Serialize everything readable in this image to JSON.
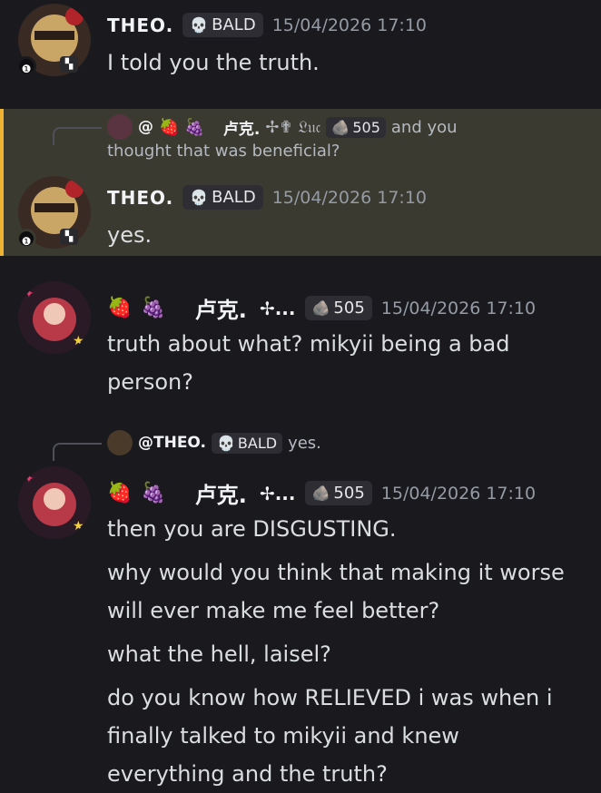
{
  "messages": [
    {
      "author": "THEO.",
      "tag": "BALD",
      "tag_icon": "skull",
      "timestamp": "15/04/2026 17:10",
      "lines": [
        "I told you the truth."
      ]
    },
    {
      "reply": {
        "mention": "@",
        "author": "卢克.",
        "suffix": "✢✟ 𝔏𝔲𝔠",
        "tag": "505",
        "text_line1": "and you",
        "text_line2": "thought that was beneficial?"
      },
      "author": "THEO.",
      "tag": "BALD",
      "timestamp": "15/04/2026 17:10",
      "lines": [
        "yes."
      ],
      "highlighted": true
    },
    {
      "author": "卢克.",
      "author_suffix": "✢...",
      "tag": "505",
      "timestamp": "15/04/2026 17:10",
      "lines": [
        "truth about what? mikyii being a bad",
        "person?"
      ]
    },
    {
      "reply": {
        "mention": "@THEO.",
        "tag": "BALD",
        "text": "yes."
      },
      "author": "卢克.",
      "author_suffix": "✢...",
      "tag": "505",
      "timestamp": "15/04/2026 17:10",
      "lines": [
        "then you are DISGUSTING.",
        "why would you think that making it worse",
        "will ever make me feel better?",
        "what the hell, laisel?",
        "do you know how RELIEVED i was when i",
        "finally talked to mikyii and knew",
        "everything and the truth?"
      ]
    }
  ],
  "emojis": {
    "strawberry": "🍓",
    "grapes": "🍇",
    "skull": "💀",
    "stone": "🪨"
  },
  "colors": {
    "background": "#1a1a1e",
    "highlight": "#3b3a30",
    "highlight_bar": "#f0b232",
    "timestamp": "#949ba4"
  }
}
